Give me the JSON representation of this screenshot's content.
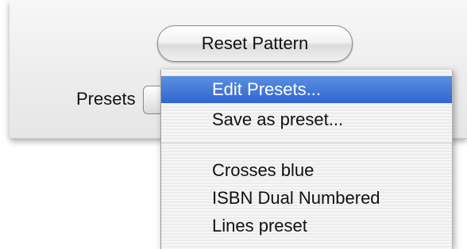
{
  "window": {
    "reset_button_label": "Reset Pattern",
    "presets_label": "Presets"
  },
  "presets_menu": {
    "selected_item": "Edit Presets...",
    "items": [
      {
        "label": "Edit Presets...",
        "selected": true
      },
      {
        "label": "Save as preset..."
      },
      {
        "label": "Crosses blue"
      },
      {
        "label": "ISBN Dual Numbered"
      },
      {
        "label": "Lines preset"
      }
    ]
  },
  "colors": {
    "selection_highlight": "#3a6fd6",
    "menu_background": "#f2f2f2"
  }
}
